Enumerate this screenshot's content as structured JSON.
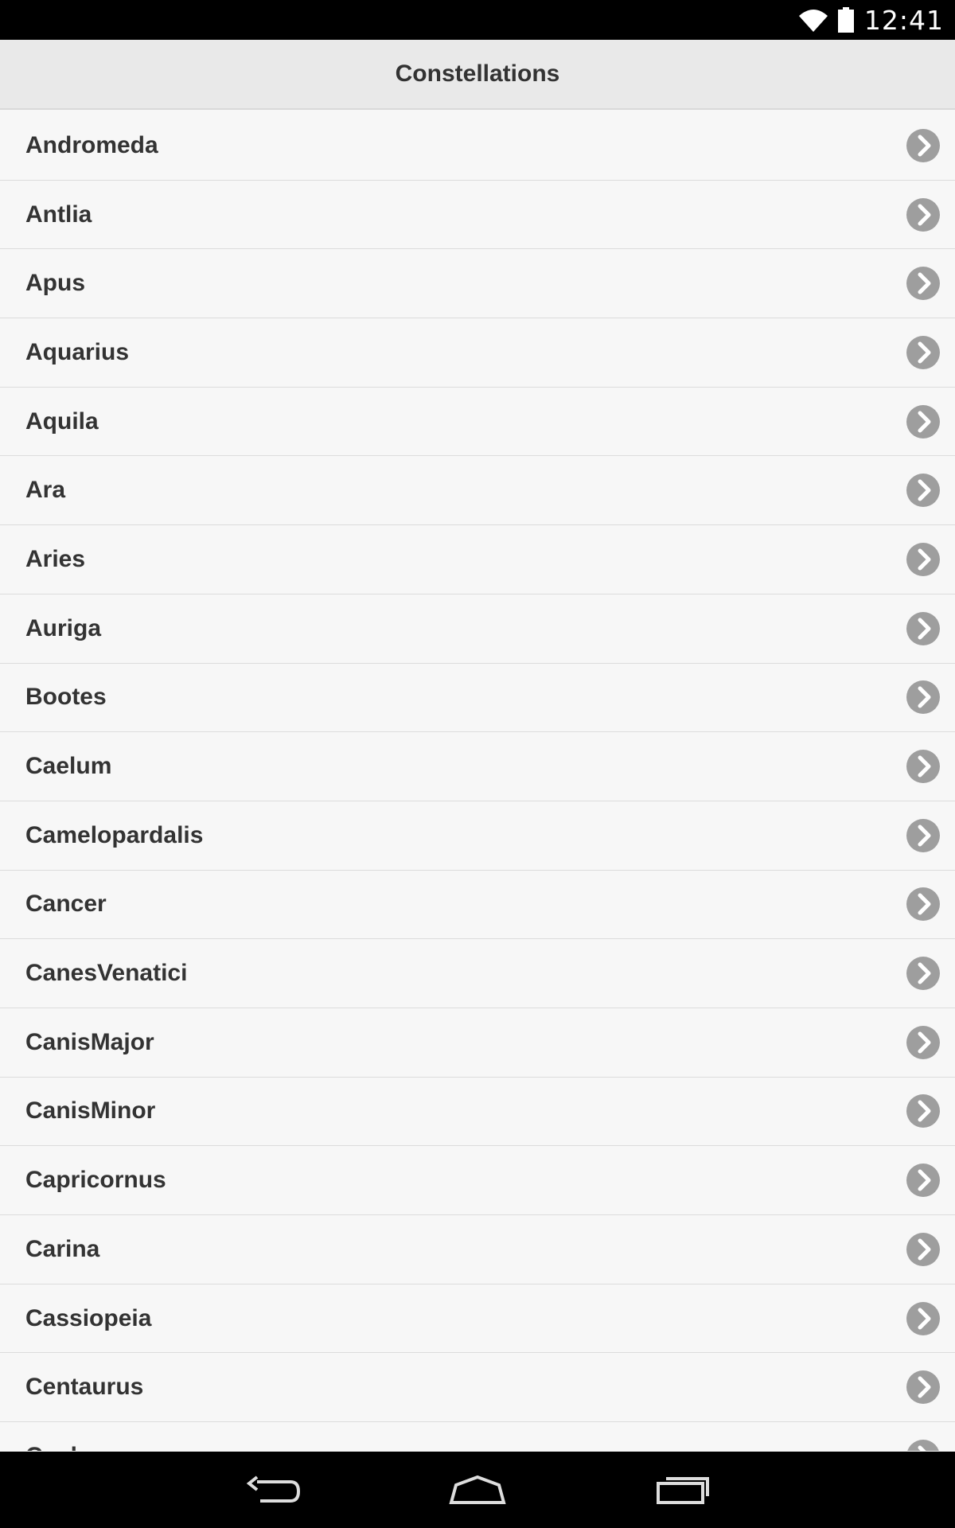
{
  "status_bar": {
    "time": "12:41",
    "icons": [
      "wifi-icon",
      "battery-icon"
    ]
  },
  "header": {
    "title": "Constellations"
  },
  "list": {
    "items": [
      {
        "label": "Andromeda"
      },
      {
        "label": "Antlia"
      },
      {
        "label": "Apus"
      },
      {
        "label": "Aquarius"
      },
      {
        "label": "Aquila"
      },
      {
        "label": "Ara"
      },
      {
        "label": "Aries"
      },
      {
        "label": "Auriga"
      },
      {
        "label": "Bootes"
      },
      {
        "label": "Caelum"
      },
      {
        "label": "Camelopardalis"
      },
      {
        "label": "Cancer"
      },
      {
        "label": "CanesVenatici"
      },
      {
        "label": "CanisMajor"
      },
      {
        "label": "CanisMinor"
      },
      {
        "label": "Capricornus"
      },
      {
        "label": "Carina"
      },
      {
        "label": "Cassiopeia"
      },
      {
        "label": "Centaurus"
      },
      {
        "label": "Cepheus"
      }
    ],
    "item_icon": "chevron-right-circle-icon"
  },
  "nav_bar": {
    "buttons": [
      "back-icon",
      "home-icon",
      "recent-apps-icon"
    ]
  },
  "colors": {
    "status_bar_bg": "#000000",
    "header_bg": "#e9e9e9",
    "list_bg": "#f7f7f7",
    "divider": "#dcdcdc",
    "text": "#333333",
    "chevron_bg": "#9e9e9e"
  }
}
